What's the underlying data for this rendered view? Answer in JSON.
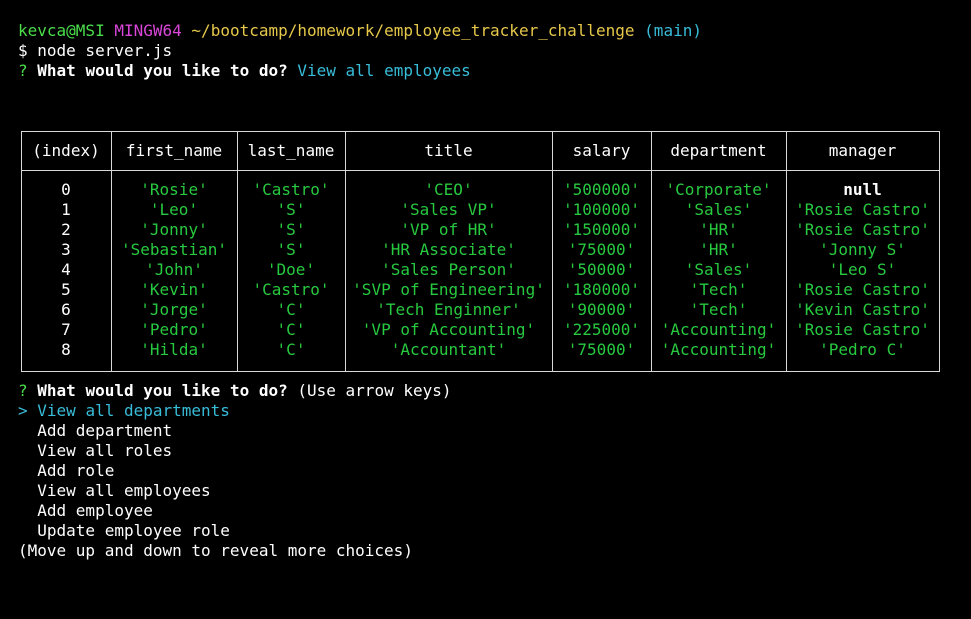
{
  "prompt": {
    "user_host": "kevca@MSI",
    "shell": "MINGW64",
    "path": "~/bootcamp/homework/employee_tracker_challenge",
    "branch": "(main)",
    "command": "$ node server.js"
  },
  "first_question": {
    "marker": "?",
    "text": "What would you like to do?",
    "answer": "View all employees"
  },
  "table": {
    "headers": [
      "(index)",
      "first_name",
      "last_name",
      "title",
      "salary",
      "department",
      "manager"
    ],
    "rows": [
      [
        "0",
        "'Rosie'",
        "'Castro'",
        "'CEO'",
        "'500000'",
        "'Corporate'",
        "null"
      ],
      [
        "1",
        "'Leo'",
        "'S'",
        "'Sales VP'",
        "'100000'",
        "'Sales'",
        "'Rosie Castro'"
      ],
      [
        "2",
        "'Jonny'",
        "'S'",
        "'VP of HR'",
        "'150000'",
        "'HR'",
        "'Rosie Castro'"
      ],
      [
        "3",
        "'Sebastian'",
        "'S'",
        "'HR Associate'",
        "'75000'",
        "'HR'",
        "'Jonny S'"
      ],
      [
        "4",
        "'John'",
        "'Doe'",
        "'Sales Person'",
        "'50000'",
        "'Sales'",
        "'Leo S'"
      ],
      [
        "5",
        "'Kevin'",
        "'Castro'",
        "'SVP of Engineering'",
        "'180000'",
        "'Tech'",
        "'Rosie Castro'"
      ],
      [
        "6",
        "'Jorge'",
        "'C'",
        "'Tech Enginner'",
        "'90000'",
        "'Tech'",
        "'Kevin Castro'"
      ],
      [
        "7",
        "'Pedro'",
        "'C'",
        "'VP of Accounting'",
        "'225000'",
        "'Accounting'",
        "'Rosie Castro'"
      ],
      [
        "8",
        "'Hilda'",
        "'C'",
        "'Accountant'",
        "'75000'",
        "'Accounting'",
        "'Pedro C'"
      ]
    ]
  },
  "second_question": {
    "marker": "?",
    "text": "What would you like to do?",
    "hint": "(Use arrow keys)"
  },
  "menu": {
    "pointer": ">",
    "selected": "View all departments",
    "items": [
      "Add department",
      "View all roles",
      "Add role",
      "View all employees",
      "Add employee",
      "Update employee role"
    ],
    "footer": "(Move up and down to reveal more choices)"
  },
  "colors": {
    "background": "#000000",
    "green": "#27c93f",
    "cyan": "#38bdd9",
    "magenta": "#d946d9",
    "yellow": "#e6c84a"
  }
}
